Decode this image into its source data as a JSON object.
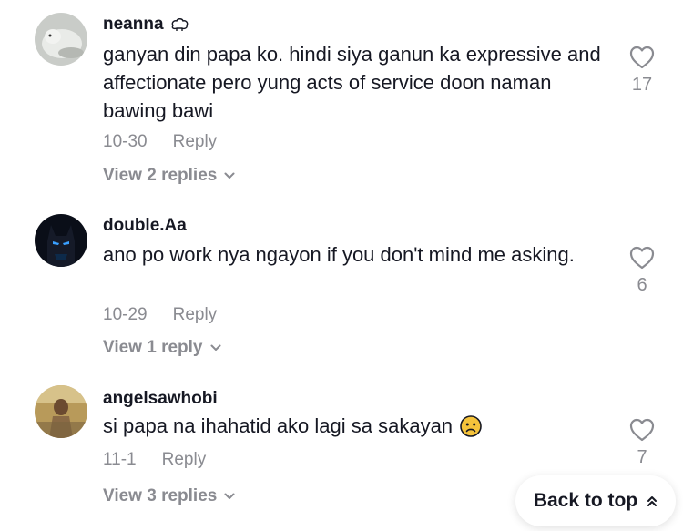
{
  "comments": [
    {
      "username": "neanna",
      "badge_icon": "sheep-icon",
      "text": "ganyan din papa ko. hindi siya ganun ka expressive and affectionate pero yung acts of service doon naman bawing bawi",
      "date": "10-30",
      "reply_label": "Reply",
      "view_replies": "View 2 replies",
      "likes": "17"
    },
    {
      "username": "double.Aa",
      "text": "ano po work nya ngayon if you don't mind me asking.",
      "date": "10-29",
      "reply_label": "Reply",
      "view_replies": "View 1 reply",
      "likes": "6"
    },
    {
      "username": "angelsawhobi",
      "text": "si papa na ihahatid ako lagi sa sakayan",
      "emoji": "frowning-face-emoji",
      "date": "11-1",
      "reply_label": "Reply",
      "view_replies": "View 3 replies",
      "likes": "7"
    }
  ],
  "back_to_top": {
    "label": "Back to top",
    "icon": "double-chevron-up-icon"
  },
  "colors": {
    "text": "#161823",
    "secondary": "#8a8b91",
    "background": "#ffffff"
  }
}
